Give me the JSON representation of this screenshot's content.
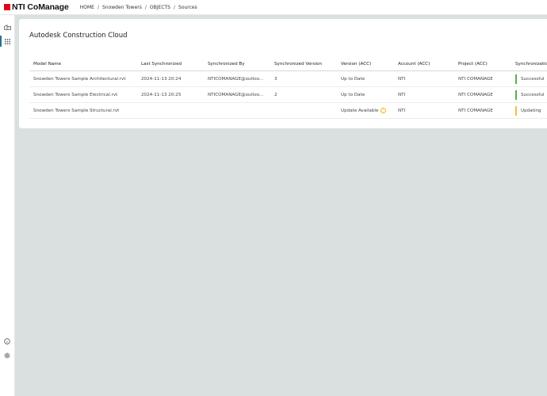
{
  "header": {
    "logo_text": "NTI CoManage",
    "breadcrumb": [
      "HOME",
      "Snowden Towers",
      "OBJECTS",
      "Sources"
    ]
  },
  "sidebar": {
    "top_icons": [
      "building-icon",
      "apps-grid-icon"
    ],
    "bottom_icons": [
      "info-icon",
      "settings-icon"
    ]
  },
  "card": {
    "title": "Autodesk Construction Cloud",
    "columns": [
      "Model Name",
      "Last Synchronized",
      "Synchronized By",
      "Synchronized Version",
      "Version (ACC)",
      "Account (ACC)",
      "Project (ACC)",
      "Synchronization"
    ],
    "rows": [
      {
        "model": "Snowden Towers Sample Architectural.rvt",
        "last_sync": "2024-11-13 20:24",
        "sync_by": "NTICOMANAGE@outloo...",
        "sync_version": "3",
        "acc_version": "Up to Date",
        "account": "NTI",
        "project": "NTI COMANAGE",
        "status": "Successful",
        "status_color": "#57b14a"
      },
      {
        "model": "Snowden Towers Sample Electrical.rvt",
        "last_sync": "2024-11-13 20:25",
        "sync_by": "NTICOMANAGE@outloo...",
        "sync_version": "2",
        "acc_version": "Up to Date",
        "account": "NTI",
        "project": "NTI COMANAGE",
        "status": "Successful",
        "status_color": "#57b14a"
      },
      {
        "model": "Snowden Towers Sample Structural.rvt",
        "last_sync": "",
        "sync_by": "",
        "sync_version": "",
        "acc_version": "Update Available",
        "account": "NTI",
        "project": "NTI COMANAGE",
        "status": "Updating",
        "status_color": "#f4c03d"
      }
    ]
  },
  "colors": {
    "brand_red": "#e3001b",
    "page_background": "#d9e0df",
    "success": "#57b14a",
    "warning": "#f4c03d"
  }
}
